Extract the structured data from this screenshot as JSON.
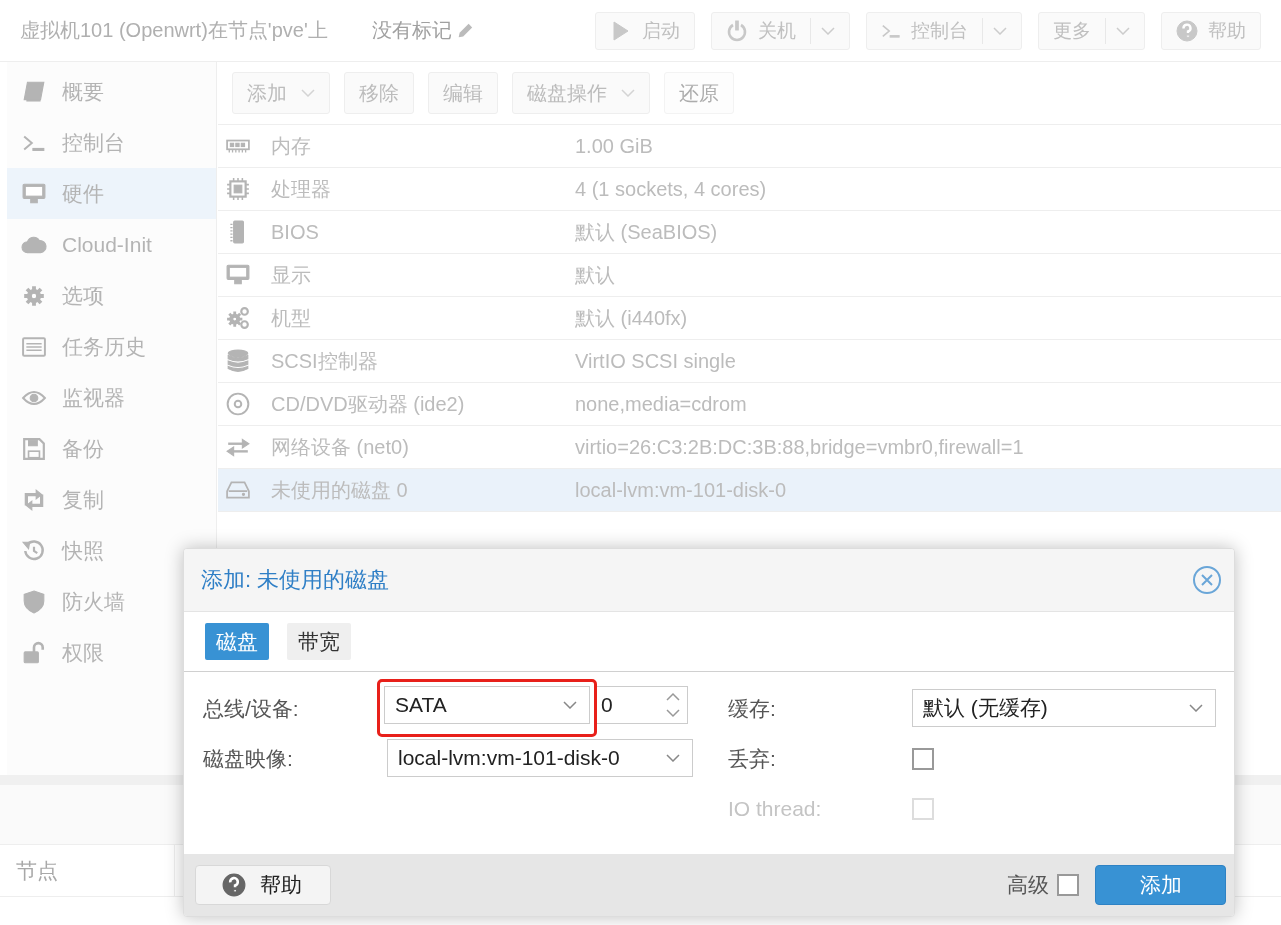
{
  "header": {
    "title": "虚拟机101 (Openwrt)在节点'pve'上",
    "tags": "没有标记",
    "buttons": [
      {
        "label": "启动",
        "kind": "play",
        "split": false
      },
      {
        "label": "关机",
        "kind": "power",
        "split": true
      },
      {
        "label": "控制台",
        "kind": "terminal",
        "split": true
      },
      {
        "label": "更多",
        "kind": "plain",
        "split": true
      },
      {
        "label": "帮助",
        "kind": "help",
        "split": false
      }
    ]
  },
  "sidebar": {
    "items": [
      {
        "label": "概要",
        "kind": "book",
        "selected": false
      },
      {
        "label": "控制台",
        "kind": "terminal",
        "selected": false
      },
      {
        "label": "硬件",
        "kind": "monitor",
        "selected": true
      },
      {
        "label": "Cloud-Init",
        "kind": "cloud",
        "selected": false
      },
      {
        "label": "选项",
        "kind": "gear",
        "selected": false
      },
      {
        "label": "任务历史",
        "kind": "list",
        "selected": false
      },
      {
        "label": "监视器",
        "kind": "eye",
        "selected": false
      },
      {
        "label": "备份",
        "kind": "floppy",
        "selected": false
      },
      {
        "label": "复制",
        "kind": "retweet",
        "selected": false
      },
      {
        "label": "快照",
        "kind": "history",
        "selected": false
      },
      {
        "label": "防火墙",
        "kind": "shield",
        "selected": false
      },
      {
        "label": "权限",
        "kind": "unlock",
        "selected": false
      }
    ]
  },
  "toolbar": [
    {
      "label": "添加",
      "menu": true,
      "disabled": false
    },
    {
      "label": "移除",
      "menu": false,
      "disabled": false
    },
    {
      "label": "编辑",
      "menu": false,
      "disabled": false
    },
    {
      "label": "磁盘操作",
      "menu": true,
      "disabled": false
    },
    {
      "label": "还原",
      "menu": false,
      "disabled": true
    }
  ],
  "hardware": [
    {
      "kind": "memory",
      "name": "内存",
      "value": "1.00 GiB",
      "selected": false
    },
    {
      "kind": "cpu",
      "name": "处理器",
      "value": "4 (1 sockets, 4 cores)",
      "selected": false
    },
    {
      "kind": "chip",
      "name": "BIOS",
      "value": "默认 (SeaBIOS)",
      "selected": false
    },
    {
      "kind": "monitor",
      "name": "显示",
      "value": "默认",
      "selected": false
    },
    {
      "kind": "gears",
      "name": "机型",
      "value": "默认 (i440fx)",
      "selected": false
    },
    {
      "kind": "database",
      "name": "SCSI控制器",
      "value": "VirtIO SCSI single",
      "selected": false
    },
    {
      "kind": "disc",
      "name": "CD/DVD驱动器 (ide2)",
      "value": "none,media=cdrom",
      "selected": false
    },
    {
      "kind": "exchange",
      "name": "网络设备 (net0)",
      "value": "virtio=26:C3:2B:DC:3B:88,bridge=vmbr0,firewall=1",
      "selected": false
    },
    {
      "kind": "hdd",
      "name": "未使用的磁盘 0",
      "value": "local-lvm:vm-101-disk-0",
      "selected": true
    }
  ],
  "log": {
    "columns": [
      "节点"
    ]
  },
  "dialog": {
    "title": "添加: 未使用的磁盘",
    "tabs": [
      {
        "label": "磁盘",
        "selected": true
      },
      {
        "label": "带宽",
        "selected": false
      }
    ],
    "bus_label": "总线/设备:",
    "bus_value": "SATA",
    "bus_highlighted": true,
    "device_value": "0",
    "image_label": "磁盘映像:",
    "image_value": "local-lvm:vm-101-disk-0",
    "cache_label": "缓存:",
    "cache_value": "默认 (无缓存)",
    "discard_label": "丢弃:",
    "discard_checked": false,
    "iothread_label": "IO thread:",
    "iothread_checked": false,
    "iothread_disabled": true,
    "help_button": "帮助",
    "advanced_label": "高级",
    "advanced_checked": false,
    "add_button": "添加"
  }
}
